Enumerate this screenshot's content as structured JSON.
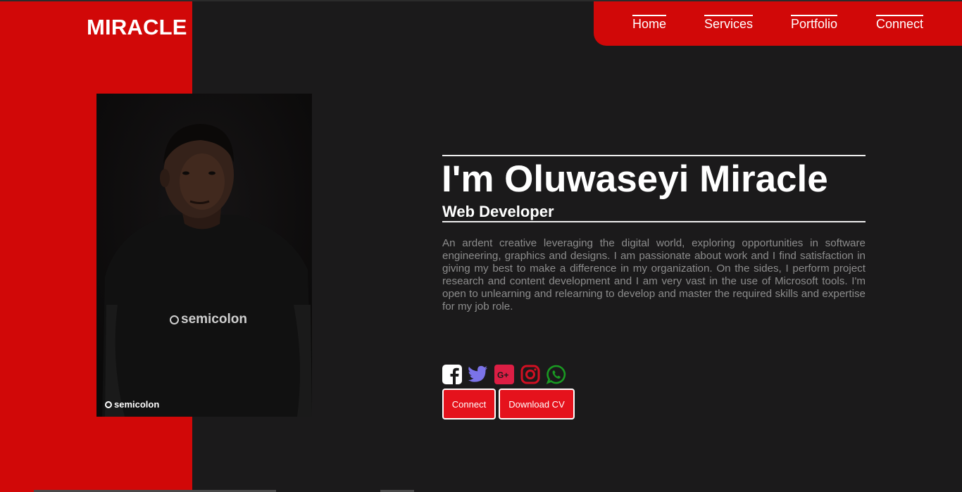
{
  "brand": {
    "logo_text": "MIRACLE",
    "accent_color": "#d10808"
  },
  "nav": {
    "items": [
      {
        "label": "Home"
      },
      {
        "label": "Services"
      },
      {
        "label": "Portfolio"
      },
      {
        "label": "Connect"
      }
    ]
  },
  "photo": {
    "shirt_text": "semicolon",
    "caption": "semicolon"
  },
  "hero": {
    "headline": "I'm Oluwaseyi Miracle",
    "role": "Web Developer",
    "bio": "An ardent creative leveraging the digital world, exploring opportunities in software engineering, graphics and designs. I am passionate about work and I find satisfaction in giving my best to make a difference in my organization. On the sides, I perform project research and content development and I am very vast in the use of Microsoft tools. I'm open to unlearning and relearning to develop and master the required skills and expertise for my job role."
  },
  "socials": [
    {
      "icon": "facebook-icon",
      "color": "#ffffff"
    },
    {
      "icon": "twitter-icon",
      "color": "#7b73e8"
    },
    {
      "icon": "google-plus-icon",
      "color": "#dc1e44"
    },
    {
      "icon": "instagram-icon",
      "color": "#d11022"
    },
    {
      "icon": "whatsapp-icon",
      "color": "#1a9a22"
    }
  ],
  "buttons": {
    "connect_label": "Connect",
    "download_label": "Download CV",
    "color": "#e5121c"
  }
}
